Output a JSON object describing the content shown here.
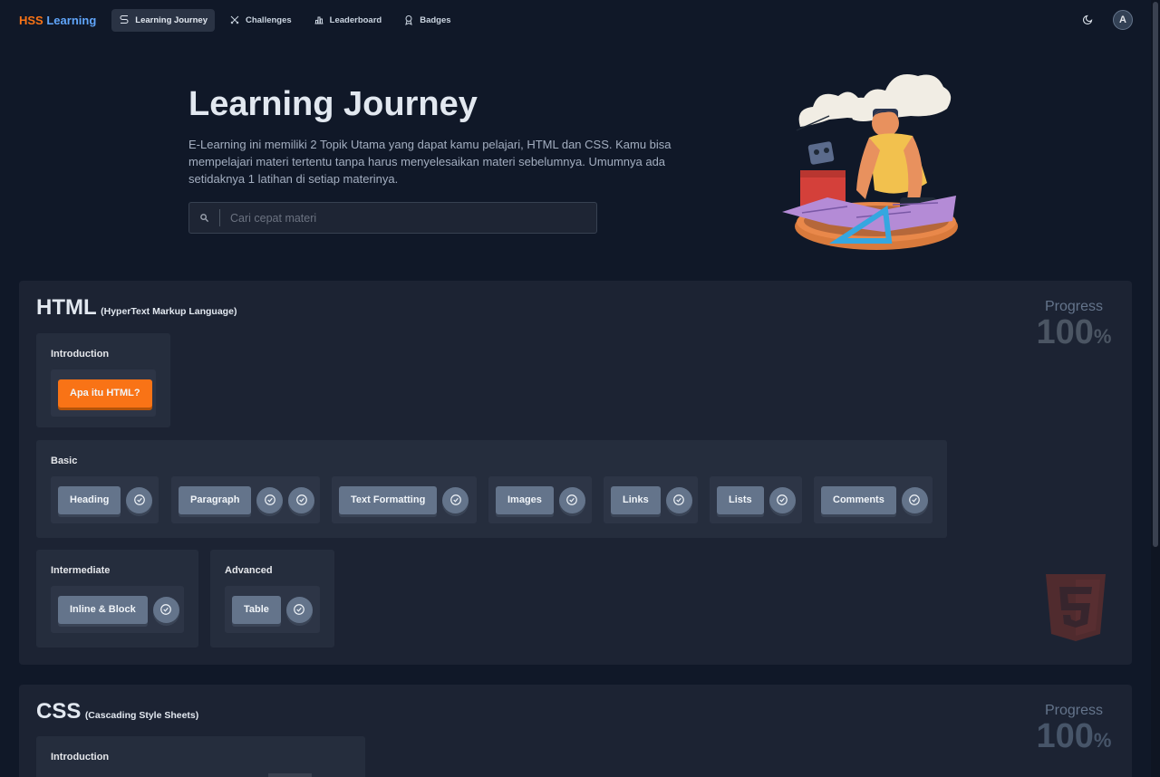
{
  "nav": {
    "brand_hss": "HSS",
    "brand_learning": "Learning",
    "items": [
      {
        "label": "Learning Journey",
        "icon": "route-icon",
        "active": true
      },
      {
        "label": "Challenges",
        "icon": "swords-icon",
        "active": false
      },
      {
        "label": "Leaderboard",
        "icon": "podium-icon",
        "active": false
      },
      {
        "label": "Badges",
        "icon": "award-icon",
        "active": false
      }
    ],
    "theme_icon": "moon-icon",
    "avatar_initial": "A"
  },
  "hero": {
    "title": "Learning Journey",
    "description": "E-Learning ini memiliki 2 Topik Utama yang dapat kamu pelajari, HTML dan CSS. Kamu bisa mempelajari materi tertentu tanpa harus menyelesaikan materi sebelumnya. Umumnya ada setidaknya 1 latihan di setiap materinya.",
    "search_placeholder": "Cari cepat materi"
  },
  "topics": {
    "html": {
      "name": "HTML",
      "full_name": "(HyperText Markup Language)",
      "progress_label": "Progress",
      "progress_value": "100",
      "progress_unit": "%",
      "groups": {
        "introduction": {
          "title": "Introduction",
          "items": [
            "Apa itu HTML?"
          ]
        },
        "basic": {
          "title": "Basic",
          "items": [
            "Heading",
            "Paragraph",
            "Text Formatting",
            "Images",
            "Links",
            "Lists",
            "Comments"
          ]
        },
        "intermediate": {
          "title": "Intermediate",
          "items": [
            "Inline & Block"
          ]
        },
        "advanced": {
          "title": "Advanced",
          "items": [
            "Table"
          ]
        }
      }
    },
    "css": {
      "name": "CSS",
      "full_name": "(Cascading Style Sheets)",
      "progress_label": "Progress",
      "progress_value": "100",
      "progress_unit": "%",
      "groups": {
        "introduction": {
          "title": "Introduction"
        }
      }
    }
  },
  "colors": {
    "background": "#101828",
    "card": "#1c2333",
    "accent_orange": "#f97316",
    "accent_blue": "#60a5fa",
    "button_gray": "#64748b"
  }
}
